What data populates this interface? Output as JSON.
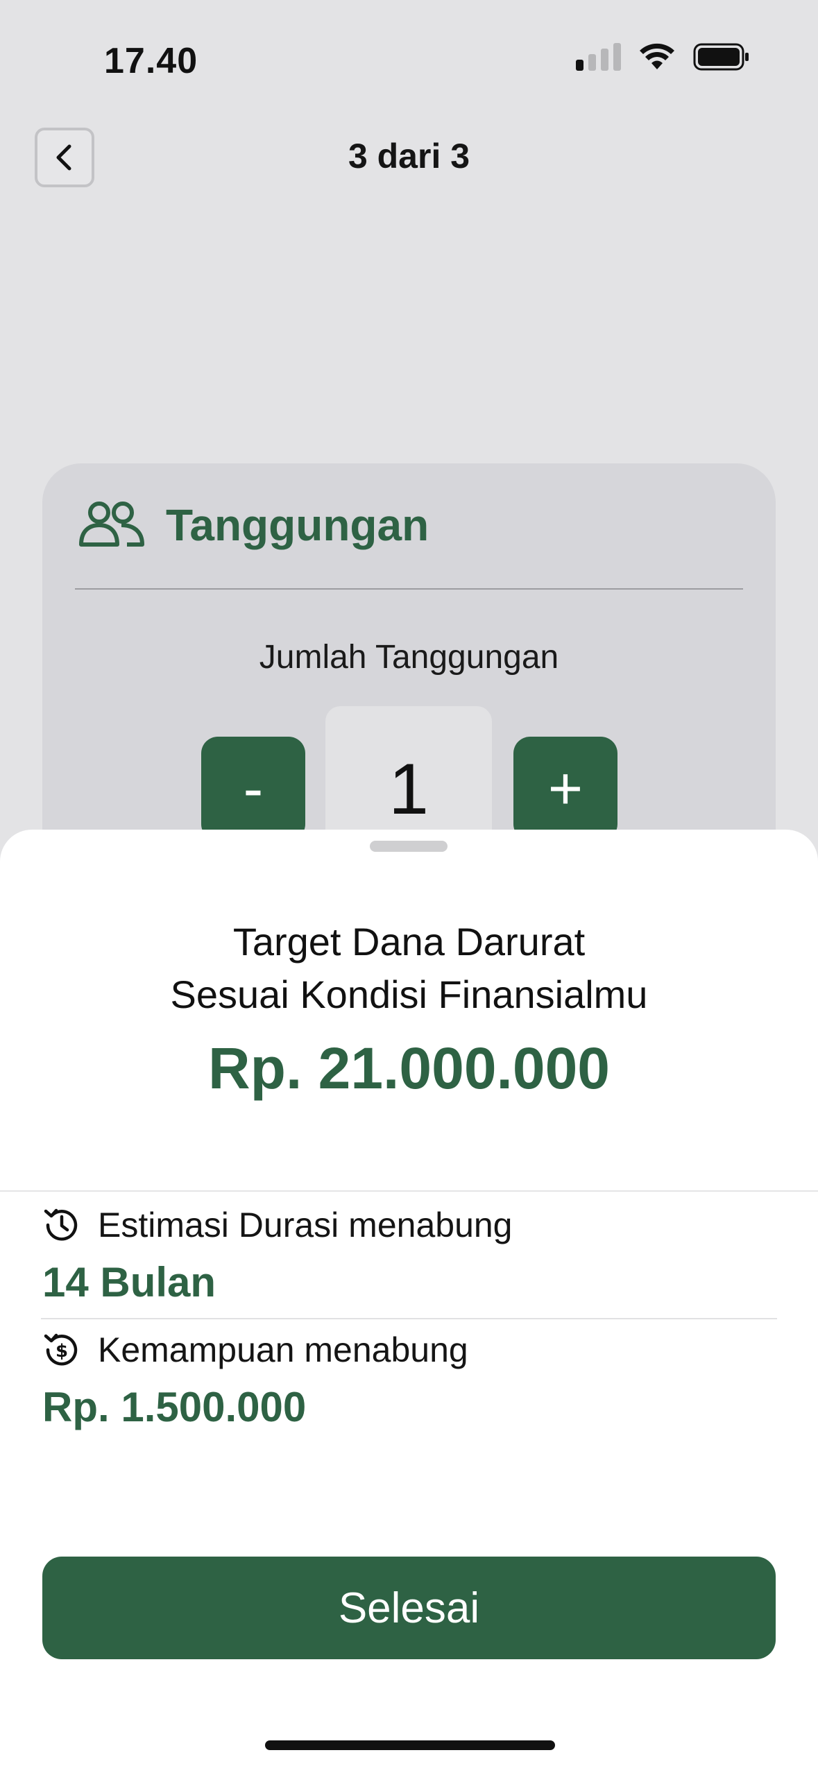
{
  "status_bar": {
    "time": "17.40",
    "icons": [
      "cellular-signal-icon",
      "wifi-icon",
      "battery-icon"
    ]
  },
  "nav": {
    "back_icon": "chevron-left-icon",
    "step_title": "3 dari 3"
  },
  "card": {
    "icon": "people-icon",
    "title": "Tanggungan",
    "count_label": "Jumlah Tanggungan",
    "minus_label": "-",
    "plus_label": "+",
    "value": "1"
  },
  "sheet": {
    "heading_line1": "Target Dana Darurat",
    "heading_line2": "Sesuai Kondisi Finansialmu",
    "target_amount": "Rp. 21.000.000",
    "duration": {
      "icon": "history-clock-icon",
      "label": "Estimasi Durasi menabung",
      "value": "14 Bulan"
    },
    "ability": {
      "icon": "money-cycle-icon",
      "label": "Kemampuan menabung",
      "value": "Rp. 1.500.000"
    },
    "finish_label": "Selesai"
  },
  "colors": {
    "accent": "#2e6244",
    "background": "#e3e3e5",
    "card": "#d6d6da",
    "sheet": "#ffffff"
  }
}
